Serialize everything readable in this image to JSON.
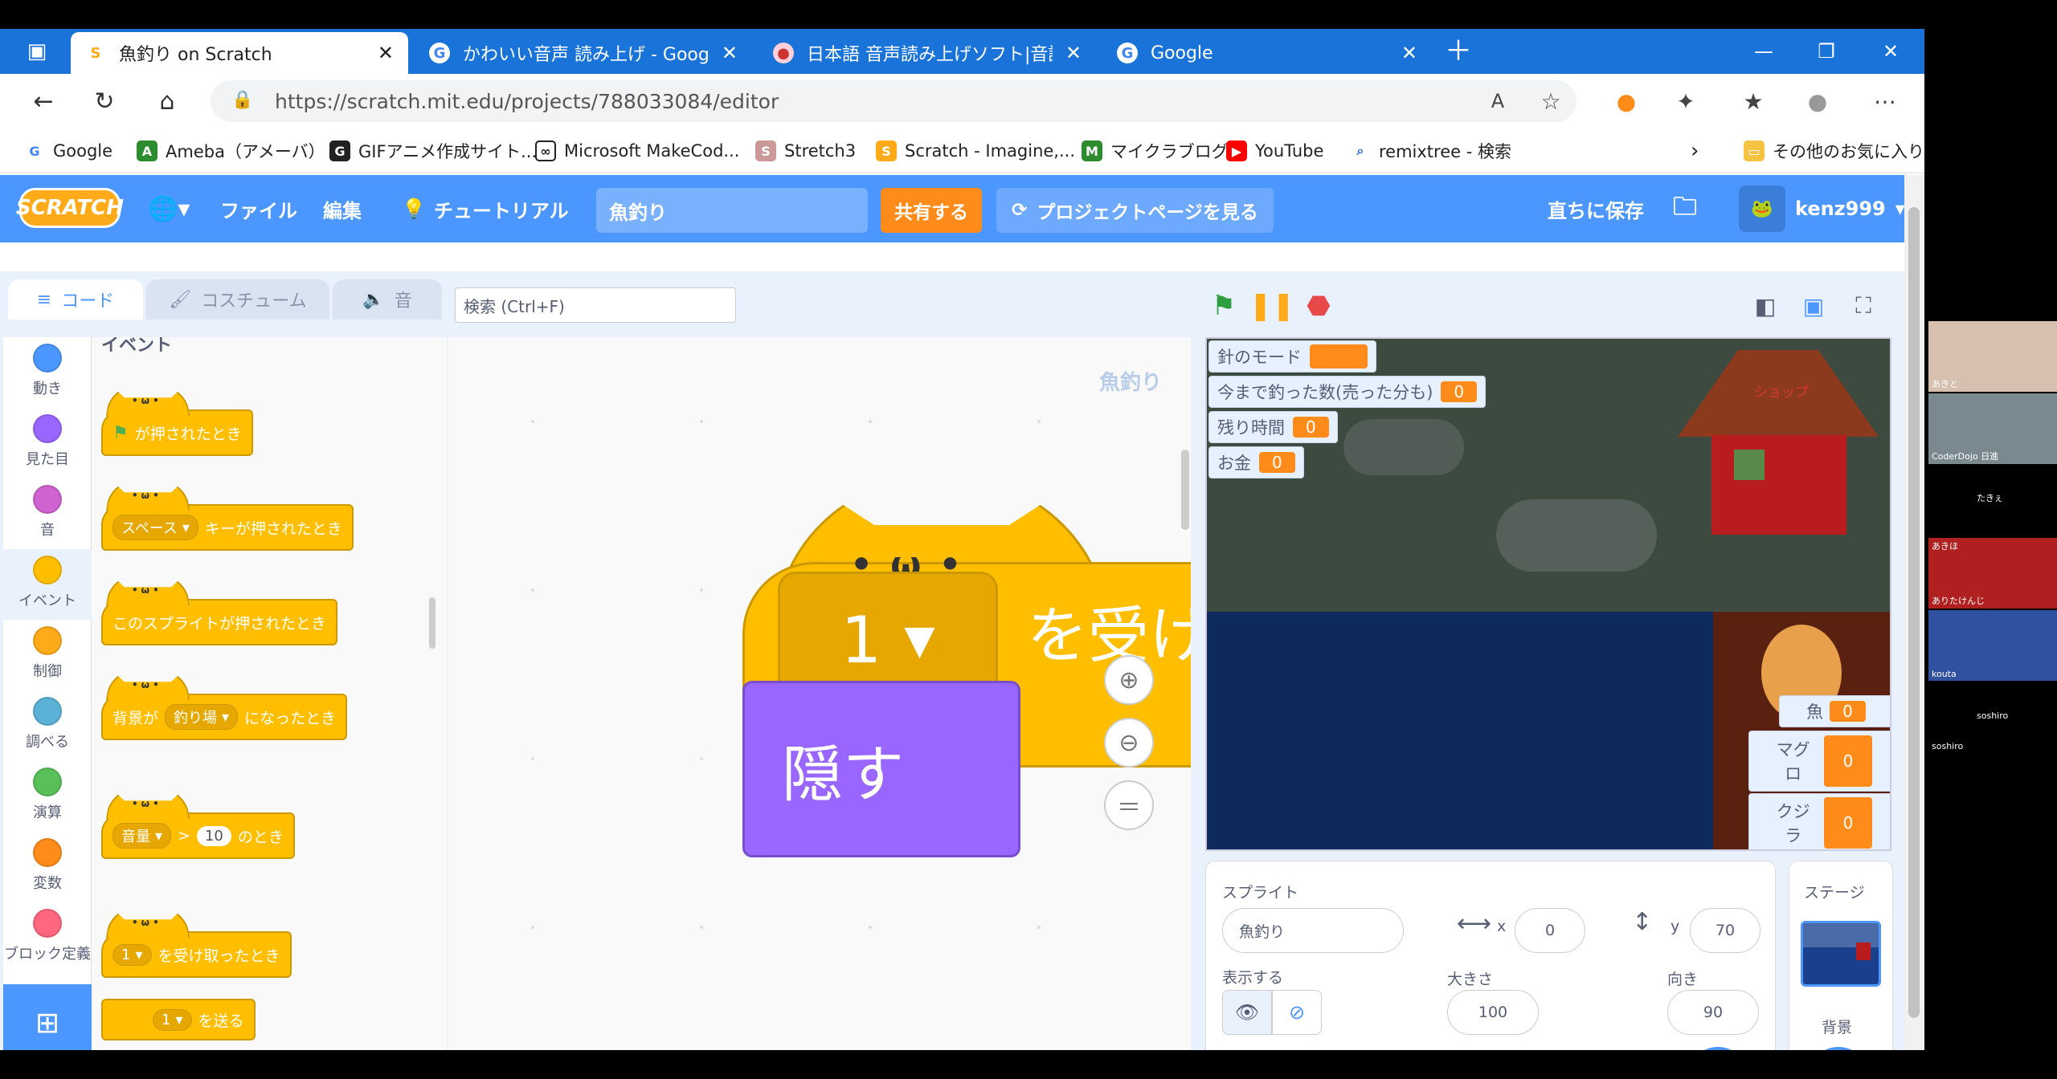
{
  "browser": {
    "tabs": [
      {
        "label": "魚釣り on Scratch",
        "active": true
      },
      {
        "label": "かわいい音声 読み上げ - Google 検",
        "active": false
      },
      {
        "label": "日本語 音声読み上げソフト|音読さ",
        "active": false
      },
      {
        "label": "Google",
        "active": false
      }
    ],
    "url": "https://scratch.mit.edu/projects/788033084/editor",
    "bookmarks": [
      "Google",
      "Ameba（アメーバ）",
      "GIFアニメ作成サイト...",
      "Microsoft MakeCod...",
      "Stretch3",
      "Scratch - Imagine,...",
      "マイクラブログ",
      "YouTube",
      "remixtree - 検索",
      "その他のお気に入り"
    ]
  },
  "menubar": {
    "logo": "SCRATCH",
    "file": "ファイル",
    "edit": "編集",
    "tutorial": "チュートリアル",
    "project_title": "魚釣り",
    "share": "共有する",
    "project_page": "プロジェクトページを見る",
    "save_now": "直ちに保存",
    "username": "kenz999"
  },
  "editor_tabs": {
    "code": "コード",
    "costume": "コスチューム",
    "sound": "音"
  },
  "categories": [
    "動き",
    "見た目",
    "音",
    "イベント",
    "制御",
    "調べる",
    "演算",
    "変数",
    "ブロック定義"
  ],
  "category_colors": [
    "#4c97ff",
    "#9966ff",
    "#cf63cf",
    "#ffbf00",
    "#ffab19",
    "#5cb1d6",
    "#59c059",
    "#ff8c1a",
    "#ff6680"
  ],
  "palette": {
    "section_title": "イベント",
    "blocks": {
      "flag_clicked": "が押されたとき",
      "key_pressed_key": "スペース",
      "key_pressed": "キーが押されたとき",
      "sprite_clicked": "このスプライトが押されたとき",
      "backdrop_prefix": "背景が",
      "backdrop_value": "釣り場",
      "backdrop_suffix": "になったとき",
      "loudness_param": "音量",
      "loudness_op": ">",
      "loudness_value": "10",
      "loudness_suffix": "のとき",
      "receive_msg": "1",
      "receive": "を受け取ったとき",
      "broadcast_msg": "1",
      "broadcast": "を送る"
    }
  },
  "search": {
    "placeholder": "検索 (Ctrl+F)"
  },
  "script": {
    "sprite_name": "魚釣り",
    "hat_msg": "1",
    "hat_text": "を受け",
    "hide_block": "隠す"
  },
  "stage": {
    "monitors": [
      {
        "label": "針のモード",
        "value": ""
      },
      {
        "label": "今まで釣った数(売った分も)",
        "value": "0"
      },
      {
        "label": "残り時間",
        "value": "0"
      },
      {
        "label": "お金",
        "value": "0"
      }
    ],
    "right_monitors": [
      {
        "label": "魚",
        "value": "0"
      },
      {
        "label": "マグロ",
        "value": "0"
      },
      {
        "label": "クジラ",
        "value": "0"
      }
    ],
    "shop_sign": "ショップ"
  },
  "sprite_info": {
    "sprite_label": "スプライト",
    "sprite_name": "魚釣り",
    "x_label": "x",
    "x": "0",
    "y_label": "y",
    "y": "70",
    "show_label": "表示する",
    "size_label": "大きさ",
    "size": "100",
    "direction_label": "向き",
    "direction": "90",
    "stage_label": "ステージ",
    "backdrop_label": "背景"
  },
  "participants": [
    "あきと",
    "CoderDojo 日進",
    "たきぇ",
    "あきほ",
    "ありたけんじ",
    "kouta",
    "soshiro",
    "soshiro"
  ]
}
